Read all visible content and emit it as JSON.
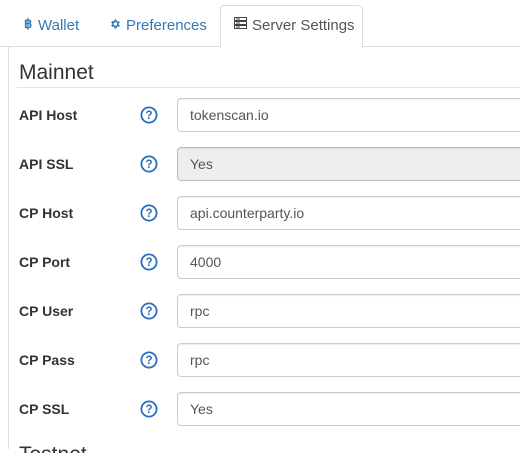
{
  "tabs": [
    {
      "label": "Wallet",
      "icon": "bitcoin-icon"
    },
    {
      "label": "Preferences",
      "icon": "gear-icon"
    },
    {
      "label": "Server Settings",
      "icon": "server-icon",
      "active": true
    }
  ],
  "section": {
    "title": "Mainnet"
  },
  "fields": [
    {
      "label": "API Host",
      "value": "tokenscan.io",
      "type": "text"
    },
    {
      "label": "API SSL",
      "value": "Yes",
      "type": "select"
    },
    {
      "label": "CP Host",
      "value": "api.counterparty.io",
      "type": "text"
    },
    {
      "label": "CP Port",
      "value": "4000",
      "type": "text"
    },
    {
      "label": "CP User",
      "value": "rpc",
      "type": "text"
    },
    {
      "label": "CP Pass",
      "value": "rpc",
      "type": "text"
    },
    {
      "label": "CP SSL",
      "value": "Yes",
      "type": "text"
    }
  ],
  "next_section": {
    "title": "Testnet"
  },
  "colors": {
    "link": "#337ab7",
    "help_icon": "#2a6ebb",
    "select_bg": "#eeeeee"
  }
}
